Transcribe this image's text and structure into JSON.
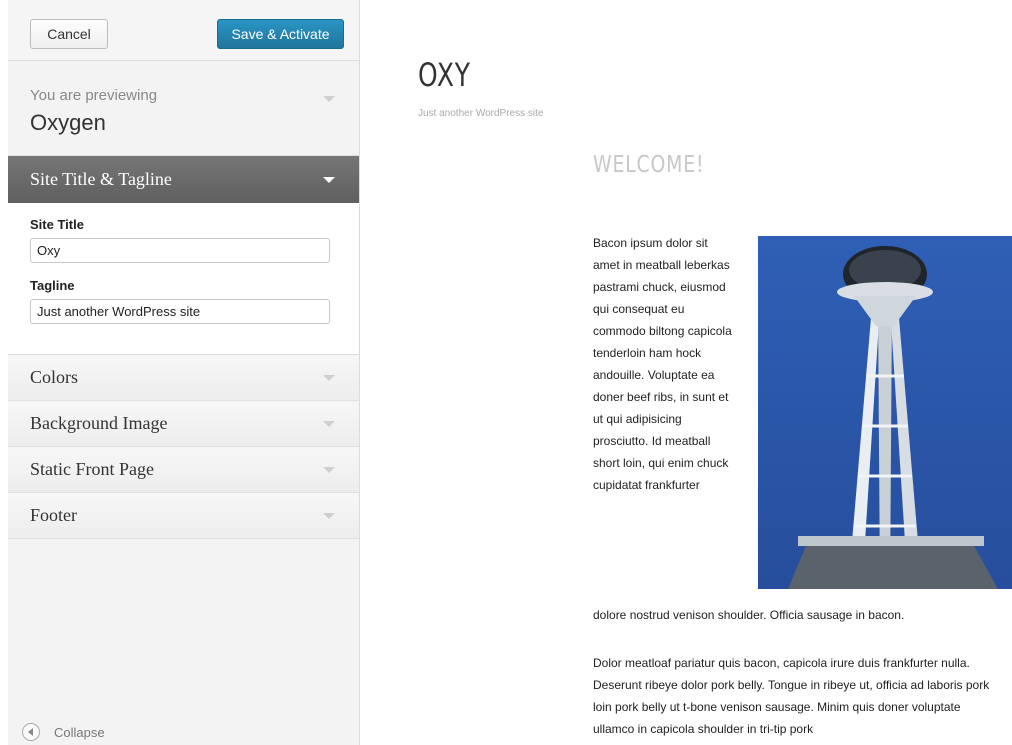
{
  "sidebar": {
    "cancel_label": "Cancel",
    "save_label": "Save & Activate",
    "previewing_label": "You are previewing",
    "theme_name": "Oxygen",
    "open_section": {
      "title": "Site Title & Tagline",
      "site_title_label": "Site Title",
      "site_title_value": "Oxy",
      "tagline_label": "Tagline",
      "tagline_value": "Just another WordPress site"
    },
    "sections": [
      "Colors",
      "Background Image",
      "Static Front Page",
      "Footer"
    ],
    "collapse_label": "Collapse"
  },
  "preview": {
    "site_title": "OXY",
    "site_tagline": "Just another WordPress site",
    "post_title": "WELCOME!",
    "paragraph1_wrapped": "Bacon ipsum dolor sit amet in meatball leberkas pastrami chuck, eiusmod qui consequat eu commodo biltong capicola tenderloin ham hock andouille. Voluptate ea doner beef ribs, in sunt et ut qui adipisicing prosciutto. Id meatball short loin, qui enim chuck cupidatat frankfurter",
    "paragraph1_end": "dolore nostrud venison shoulder. Officia sausage in bacon.",
    "paragraph2": "Dolor meatloaf pariatur quis bacon, capicola irure duis frankfurter nulla. Deserunt ribeye dolor pork belly. Tongue in ribeye ut, officia ad laboris pork loin pork belly ut t-bone venison sausage. Minim quis doner voluptate ullamco in capicola shoulder in tri-tip pork"
  },
  "colors": {
    "accent_button": "#21759b",
    "open_section_bg": "#6b6b6b",
    "sky_blue": "#2d56a6"
  },
  "icons": {
    "section_toggle": "chevron-down-icon",
    "collapse": "collapse-arrow-icon"
  }
}
